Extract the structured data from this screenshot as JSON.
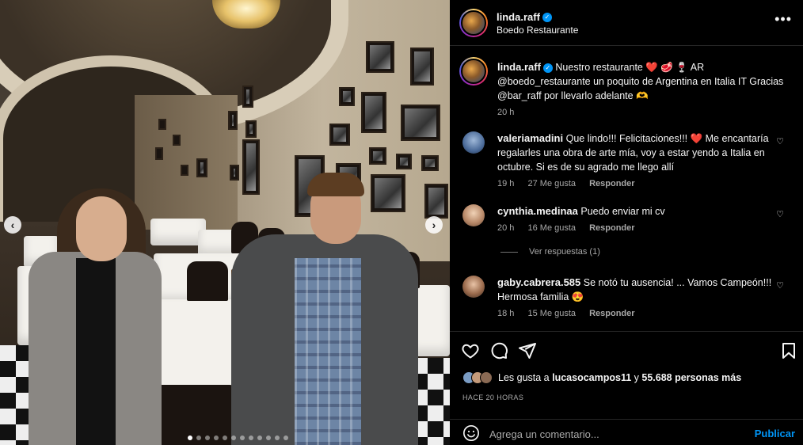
{
  "header": {
    "username": "linda.raff",
    "location": "Boedo Restaurante"
  },
  "caption": {
    "username": "linda.raff",
    "text": "Nuestro restaurante ❤️ 🥩 🍷 AR @boedo_restaurante un poquito de Argentina en Italia IT Gracias @bar_raff por llevarlo adelante 🫶",
    "time": "20 h"
  },
  "comments": [
    {
      "username": "valeriamadini",
      "text": "Que lindo!!! Felicitaciones!!! ❤️ Me encantaría regalarles una obra de arte mía, voy a estar yendo a Italia en octubre. Si es de su agrado me llego allí",
      "time": "19 h",
      "likes": "27 Me gusta",
      "reply": "Responder"
    },
    {
      "username": "cynthia.medinaa",
      "text": "Puedo enviar mi cv",
      "time": "20 h",
      "likes": "16 Me gusta",
      "reply": "Responder"
    },
    {
      "username": "gaby.cabrera.585",
      "text": "Se notó tu ausencia! ... Vamos Campeón!!! Hermosa familia 😍",
      "time": "18 h",
      "likes": "15 Me gusta",
      "reply": "Responder"
    }
  ],
  "view_replies": "Ver respuestas (1)",
  "likes": {
    "prefix": "Les gusta a ",
    "user": "lucasocampos11",
    "middle": " y ",
    "count": "55.688 personas más"
  },
  "posted_ago": "HACE 20 HORAS",
  "composer": {
    "placeholder": "Agrega un comentario...",
    "publish_label": "Publicar"
  },
  "carousel": {
    "prev_icon": "chevron-left-icon",
    "next_icon": "chevron-right-icon",
    "slide_count": 12,
    "active_index": 0
  },
  "colors": {
    "background": "#000000",
    "text": "#f5f5f5",
    "muted": "#a8a8a8",
    "accent": "#0095f6",
    "heart": "#ff3040"
  }
}
